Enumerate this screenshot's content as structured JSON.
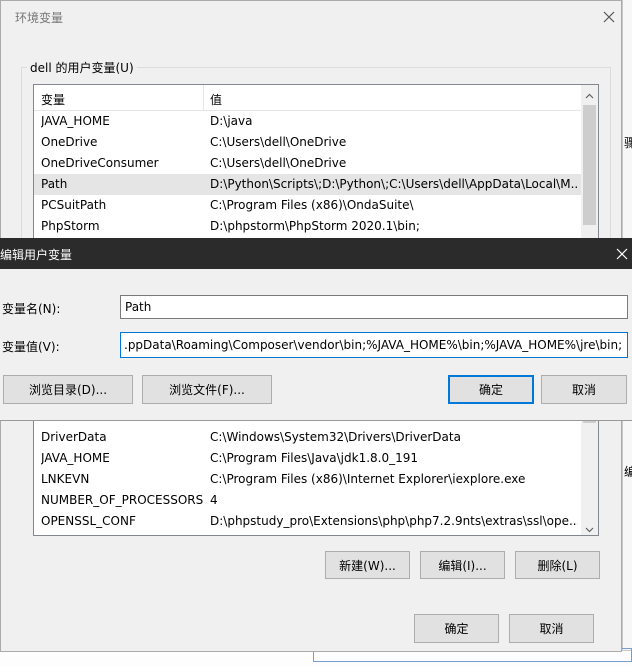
{
  "env_dialog": {
    "title": "环境变量",
    "user_group_label": "dell 的用户变量(U)",
    "col_name": "变量",
    "col_value": "值",
    "user_vars": [
      {
        "name": "JAVA_HOME",
        "value": "D:\\java"
      },
      {
        "name": "OneDrive",
        "value": "C:\\Users\\dell\\OneDrive"
      },
      {
        "name": "OneDriveConsumer",
        "value": "C:\\Users\\dell\\OneDrive"
      },
      {
        "name": "Path",
        "value": "D:\\Python\\Scripts\\;D:\\Python\\;C:\\Users\\dell\\AppData\\Local\\M..."
      },
      {
        "name": "PCSuitPath",
        "value": "C:\\Program Files (x86)\\OndaSuite\\"
      },
      {
        "name": "PhpStorm",
        "value": "D:\\phpstorm\\PhpStorm 2020.1\\bin;"
      }
    ],
    "system_vars": [
      {
        "name": "DriverData",
        "value": "C:\\Windows\\System32\\Drivers\\DriverData"
      },
      {
        "name": "JAVA_HOME",
        "value": "C:\\Program Files\\Java\\jdk1.8.0_191"
      },
      {
        "name": "LNKEVN",
        "value": "C:\\Program Files (x86)\\Internet Explorer\\iexplore.exe"
      },
      {
        "name": "NUMBER_OF_PROCESSORS",
        "value": "4"
      },
      {
        "name": "OPENSSL_CONF",
        "value": "D:\\phpstudy_pro\\Extensions\\php\\php7.2.9nts\\extras\\ssl\\ope..."
      }
    ],
    "new_button": "新建(W)...",
    "edit_button": "编辑(I)...",
    "delete_button": "删除(L)",
    "ok_button": "确定",
    "cancel_button": "取消"
  },
  "edit_dialog": {
    "title": "编辑用户变量",
    "name_label": "变量名(N):",
    "name_value": "Path",
    "value_label": "变量值(V):",
    "value_value": ".ppData\\Roaming\\Composer\\vendor\\bin;%JAVA_HOME%\\bin;%JAVA_HOME%\\jre\\bin;",
    "browse_dir_button": "浏览目录(D)...",
    "browse_file_button": "浏览文件(F)...",
    "ok_button": "确定",
    "cancel_button": "取消"
  },
  "background": {
    "edge_text_1": "骤",
    "edge_text_2": "编"
  },
  "colors": {
    "accent": "#0078d7",
    "selected_row": "#e5e5e5",
    "edit_titlebar": "#2b2b2b"
  }
}
